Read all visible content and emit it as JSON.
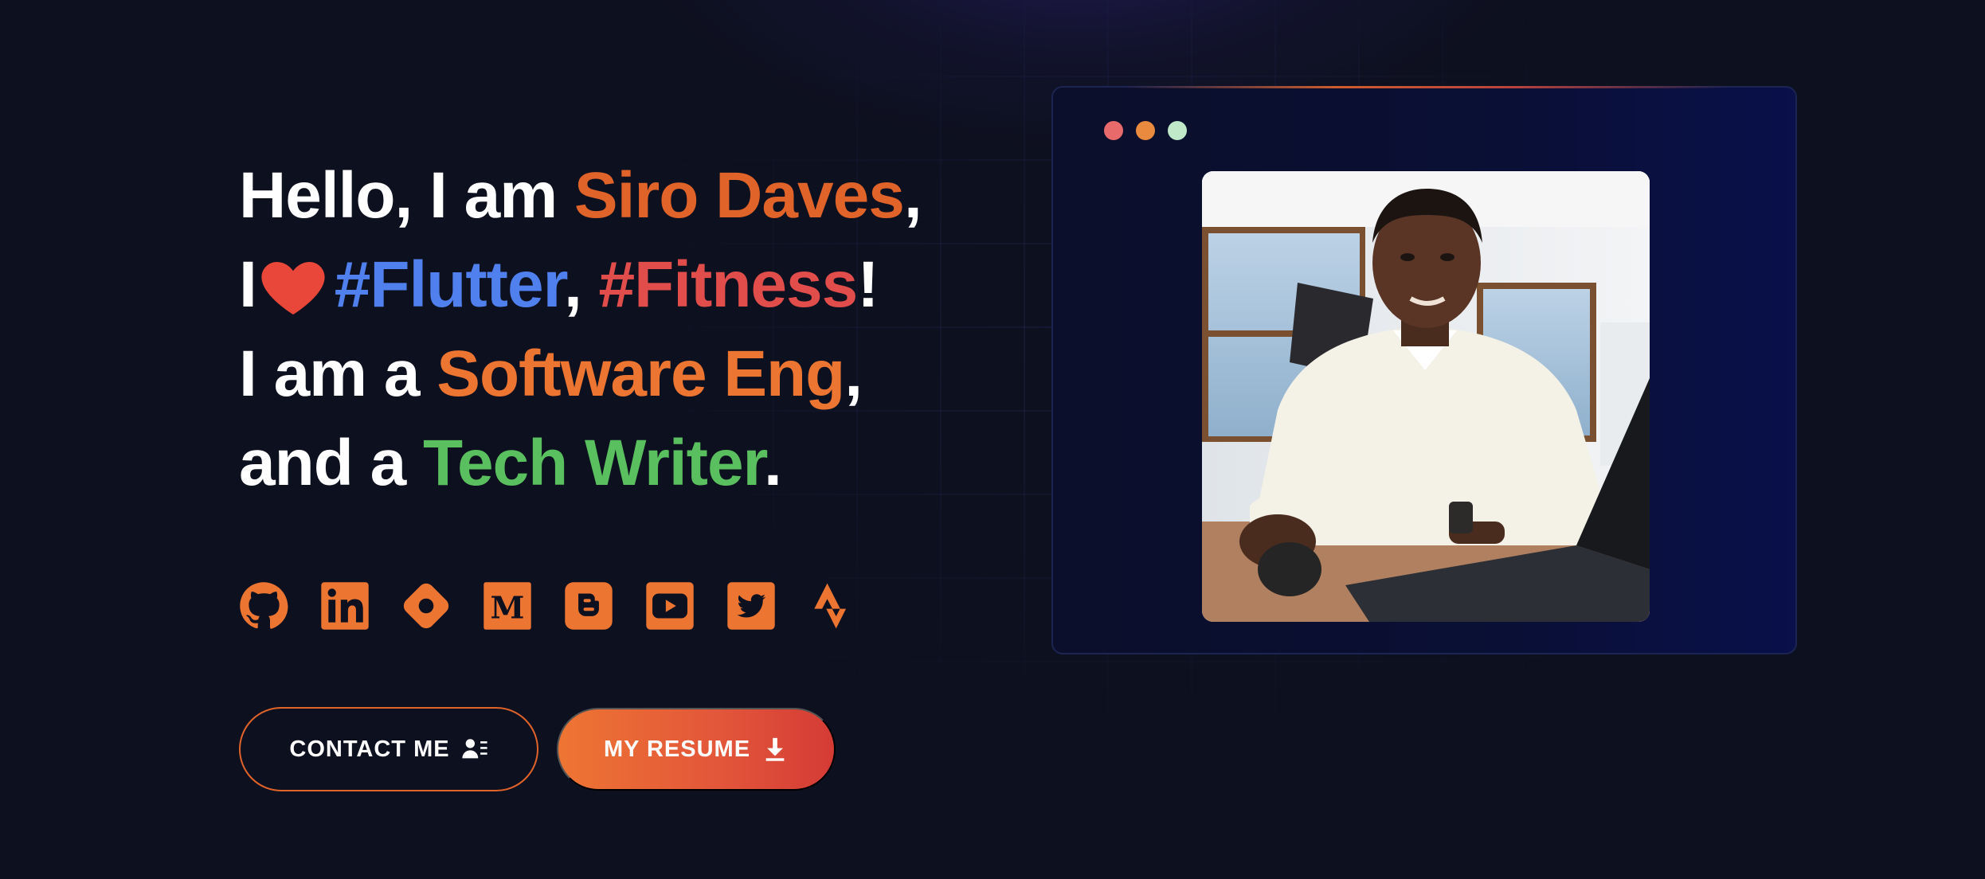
{
  "hero": {
    "line1": {
      "pre": "Hello, I am ",
      "name": "Siro Daves",
      "post": ","
    },
    "line2": {
      "pre": "I",
      "tag1": "#Flutter",
      "sep": ", ",
      "tag2": "#Fitness",
      "post": "!"
    },
    "line3": {
      "pre": "I am a ",
      "role": "Software Eng",
      "post": ","
    },
    "line4": {
      "pre": "and a ",
      "role": "Tech Writer",
      "post": "."
    }
  },
  "socials": [
    {
      "icon": "github-icon"
    },
    {
      "icon": "linkedin-icon"
    },
    {
      "icon": "hashnode-icon"
    },
    {
      "icon": "medium-icon"
    },
    {
      "icon": "blogger-icon"
    },
    {
      "icon": "youtube-icon"
    },
    {
      "icon": "twitter-icon"
    },
    {
      "icon": "strava-icon"
    }
  ],
  "buttons": {
    "contact_label": "CONTACT ME",
    "resume_label": "MY RESUME"
  },
  "colors": {
    "background": "#0d101e",
    "accent_orange": "#e0632a",
    "flutter_blue": "#4f80ee",
    "fitness_red": "#e04d4b",
    "writer_green": "#5abf5e"
  }
}
